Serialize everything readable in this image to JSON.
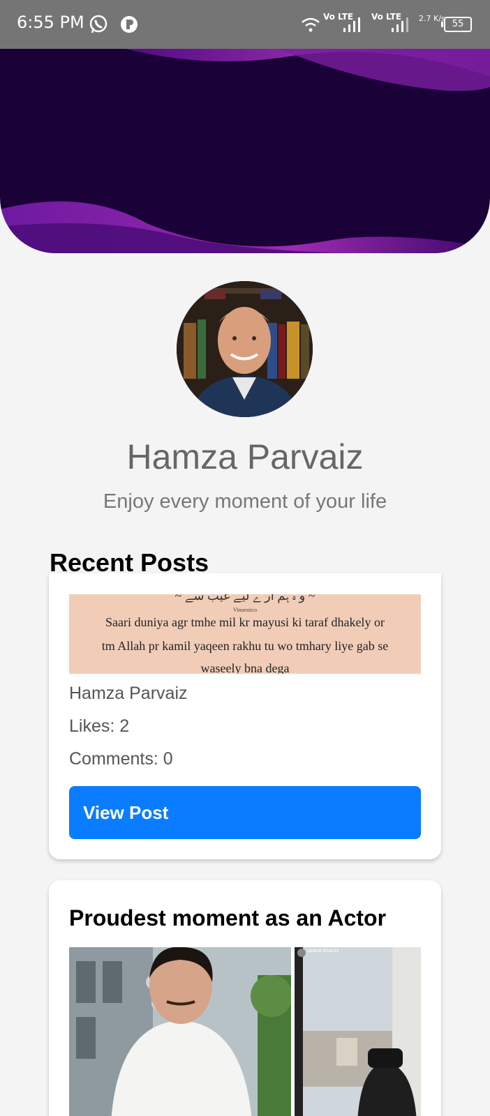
{
  "status_bar": {
    "time": "6:55 PM",
    "icons": [
      "whatsapp-icon",
      "app-notification-icon",
      "wifi-icon",
      "signal-icon"
    ],
    "network_1": "Vo LTE",
    "network_2": "Vo LTE",
    "speed": "2.7 K/s",
    "battery": "55"
  },
  "profile": {
    "name": "Hamza Parvaiz",
    "bio": "Enjoy every moment of your life"
  },
  "recent_posts_title": "Recent Posts",
  "posts": [
    {
      "image_lines": [
        "Vinuestico",
        "Saari duniya agr tmhe mil kr mayusi ki taraf dhakely or",
        "tm Allah pr kamil yaqeen rakhu tu wo tmhary liye gab se",
        "waseely bna dega"
      ],
      "author": "Hamza Parvaiz",
      "likes": "Likes: 2",
      "comments": "Comments: 0",
      "button": "View Post"
    },
    {
      "title": "Proudest moment as an Actor",
      "story_user": "usama.khan11"
    }
  ],
  "colors": {
    "banner": "#1a0138",
    "accent_button": "#0a7cff",
    "status_bar": "#757575"
  }
}
